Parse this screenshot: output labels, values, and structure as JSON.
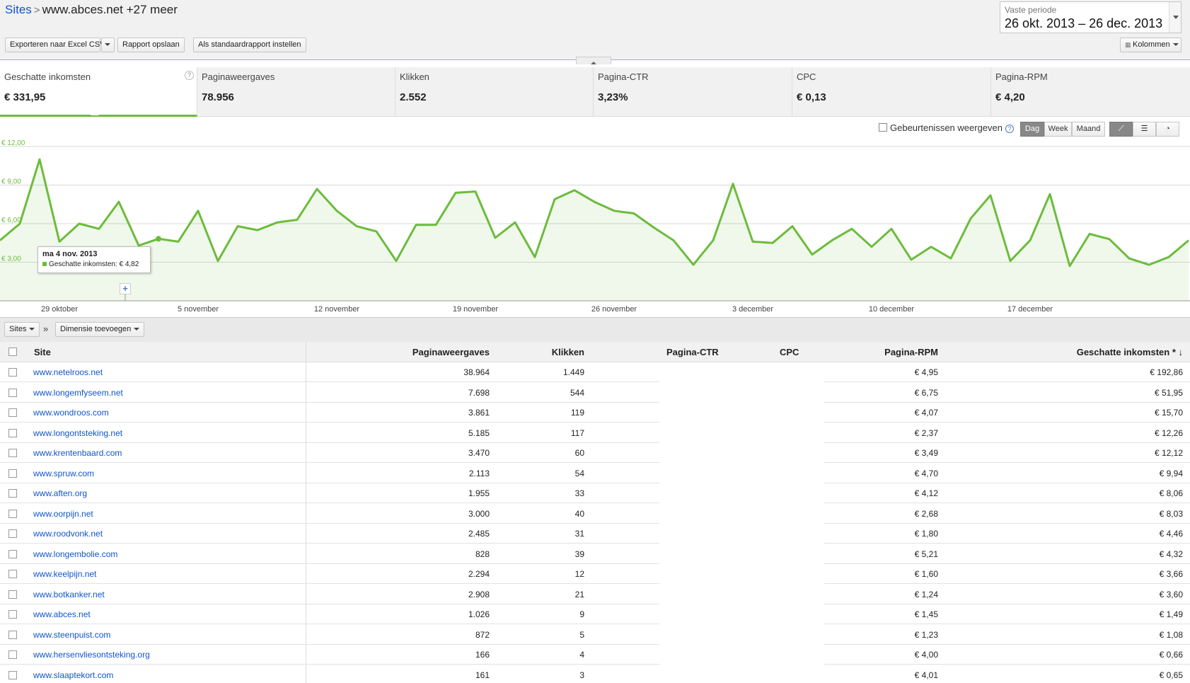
{
  "breadcrumb": {
    "root": "Sites",
    "separator": ">",
    "current": "www.abces.net +27 meer"
  },
  "period": {
    "label": "Vaste periode",
    "range": "26 okt. 2013 – 26 dec. 2013"
  },
  "toolbar": {
    "export_label": "Exporteren naar Excel CSV",
    "save_label": "Rapport opslaan",
    "default_label": "Als standaardrapport instellen",
    "columns_label": "Kolommen"
  },
  "scorecards": [
    {
      "label": "Geschatte inkomsten",
      "value": "€ 331,95"
    },
    {
      "label": "Paginaweergaves",
      "value": "78.956"
    },
    {
      "label": "Klikken",
      "value": "2.552"
    },
    {
      "label": "Pagina-CTR",
      "value": "3,23%"
    },
    {
      "label": "CPC",
      "value": "€ 0,13"
    },
    {
      "label": "Pagina-RPM",
      "value": "€ 4,20"
    }
  ],
  "chart_controls": {
    "events_label": "Gebeurtenissen weergeven",
    "granularity": [
      "Dag",
      "Week",
      "Maand"
    ],
    "selected_granularity": "Dag"
  },
  "chart_data": {
    "type": "area",
    "series": [
      {
        "name": "Geschatte inkomsten",
        "values": [
          4.7,
          6.0,
          11.0,
          4.6,
          6.0,
          5.6,
          7.7,
          4.3,
          4.82,
          4.6,
          7.0,
          3.1,
          5.8,
          5.5,
          6.1,
          6.3,
          8.7,
          7.0,
          5.8,
          5.4,
          3.1,
          5.9,
          5.9,
          8.4,
          8.5,
          4.9,
          6.1,
          3.4,
          7.9,
          8.6,
          7.7,
          7.0,
          6.8,
          5.7,
          4.7,
          2.8,
          4.7,
          9.1,
          4.6,
          4.5,
          5.8,
          3.6,
          4.7,
          5.6,
          4.2,
          5.6,
          3.2,
          4.2,
          3.3,
          6.4,
          8.2,
          3.1,
          4.7,
          8.3,
          2.7,
          5.2,
          4.8,
          3.3,
          2.8,
          3.4,
          4.7
        ],
        "color": "#6cbc3c"
      }
    ],
    "y_ticks": [
      "€ 3,00",
      "€ 6,00",
      "€ 9,00",
      "€ 12,00"
    ],
    "ylim": [
      0,
      12
    ],
    "x_ticks": [
      "29 oktober",
      "5 november",
      "12 november",
      "19 november",
      "26 november",
      "3 december",
      "10 december",
      "17 december"
    ],
    "tooltip": {
      "date": "ma 4 nov. 2013",
      "label": "Geschatte inkomsten: € 4,82"
    },
    "grid": true
  },
  "dimension_bar": {
    "primary": "Sites",
    "separator": "»",
    "add_label": "Dimensie toevoegen"
  },
  "table": {
    "headers": [
      "Site",
      "Paginaweergaves",
      "Klikken",
      "Pagina-CTR",
      "CPC",
      "Pagina-RPM",
      "Geschatte inkomsten * ↓"
    ],
    "rows": [
      [
        "www.netelroos.net",
        "38.964",
        "1.449",
        "€ 4,95",
        "€ 192,86"
      ],
      [
        "www.longemfyseem.net",
        "7.698",
        "544",
        "€ 6,75",
        "€ 51,95"
      ],
      [
        "www.wondroos.com",
        "3.861",
        "119",
        "€ 4,07",
        "€ 15,70"
      ],
      [
        "www.longontsteking.net",
        "5.185",
        "117",
        "€ 2,37",
        "€ 12,26"
      ],
      [
        "www.krentenbaard.com",
        "3.470",
        "60",
        "€ 3,49",
        "€ 12,12"
      ],
      [
        "www.spruw.com",
        "2.113",
        "54",
        "€ 4,70",
        "€ 9,94"
      ],
      [
        "www.aften.org",
        "1.955",
        "33",
        "€ 4,12",
        "€ 8,06"
      ],
      [
        "www.oorpijn.net",
        "3.000",
        "40",
        "€ 2,68",
        "€ 8,03"
      ],
      [
        "www.roodvonk.net",
        "2.485",
        "31",
        "€ 1,80",
        "€ 4,46"
      ],
      [
        "www.longembolie.com",
        "828",
        "39",
        "€ 5,21",
        "€ 4,32"
      ],
      [
        "www.keelpijn.net",
        "2.294",
        "12",
        "€ 1,60",
        "€ 3,66"
      ],
      [
        "www.botkanker.net",
        "2.908",
        "21",
        "€ 1,24",
        "€ 3,60"
      ],
      [
        "www.abces.net",
        "1.026",
        "9",
        "€ 1,45",
        "€ 1,49"
      ],
      [
        "www.steenpuist.com",
        "872",
        "5",
        "€ 1,23",
        "€ 1,08"
      ],
      [
        "www.hersenvliesontsteking.org",
        "166",
        "4",
        "€ 4,00",
        "€ 0,66"
      ],
      [
        "www.slaaptekort.com",
        "161",
        "3",
        "€ 4,01",
        "€ 0,65"
      ]
    ]
  }
}
